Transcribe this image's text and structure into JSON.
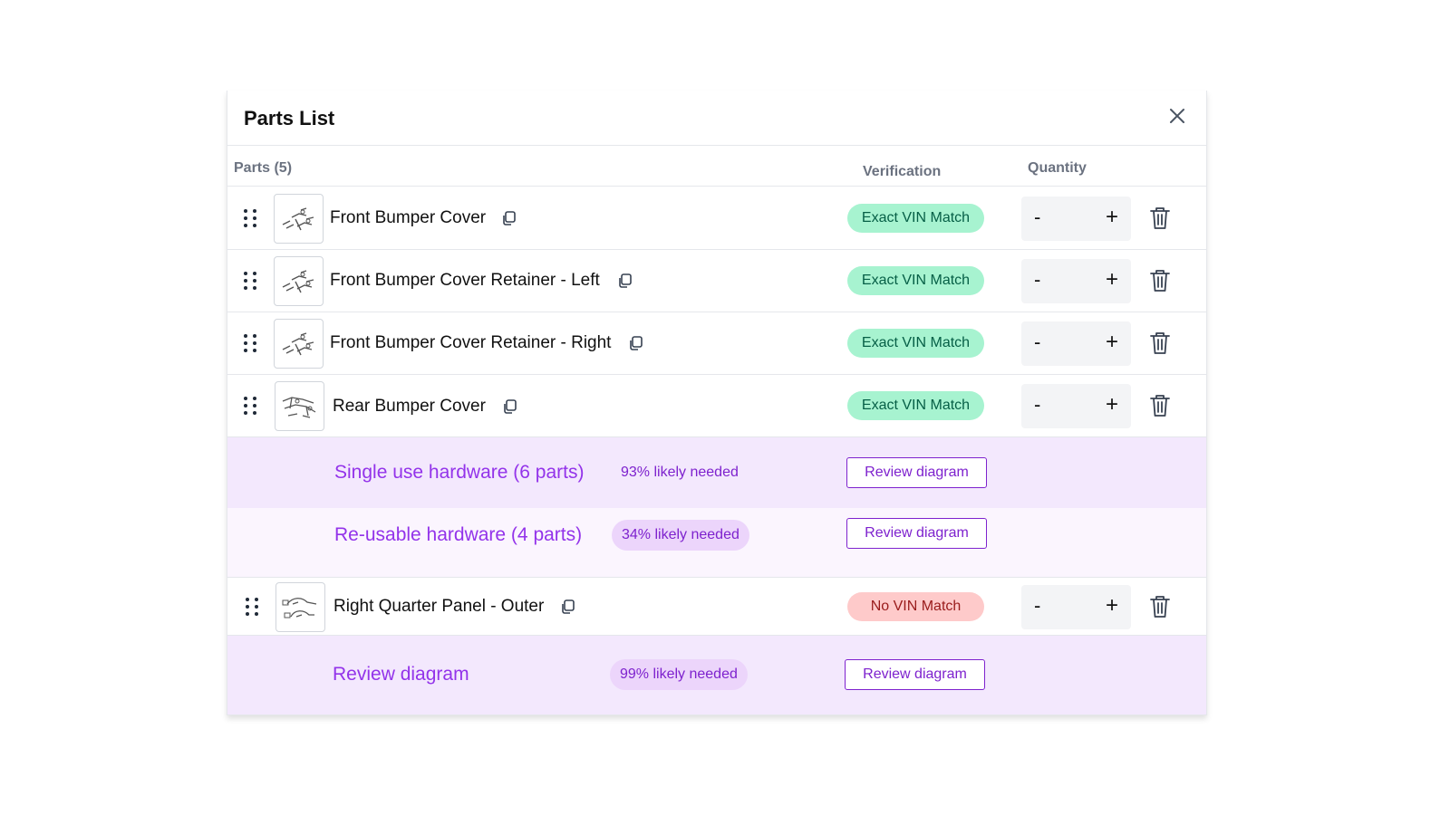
{
  "panel": {
    "title": "Parts List",
    "close_icon": "close-icon"
  },
  "columns": {
    "parts": "Parts (5)",
    "verification": "Verification",
    "quantity": "Quantity"
  },
  "parts": [
    {
      "name": "Front Bumper Cover",
      "verification": "Exact VIN Match",
      "status": "ok"
    },
    {
      "name": "Front Bumper Cover Retainer - Left",
      "verification": "Exact VIN Match",
      "status": "ok"
    },
    {
      "name": "Front Bumper Cover Retainer - Right",
      "verification": "Exact VIN Match",
      "status": "ok"
    },
    {
      "name": "Rear Bumper Cover",
      "verification": "Exact VIN Match",
      "status": "ok"
    },
    {
      "name": "Right Quarter Panel - Outer",
      "verification": "No VIN Match",
      "status": "bad"
    }
  ],
  "quantity_controls": {
    "minus": "-",
    "plus": "+"
  },
  "hardware": [
    {
      "title": "Single use hardware (6 parts)",
      "likelihood": "93% likely needed",
      "button": "Review diagram"
    },
    {
      "title": "Re-usable hardware (4 parts)",
      "likelihood": "34% likely needed",
      "button": "Review diagram"
    },
    {
      "title": "Review diagram",
      "likelihood": "99% likely needed",
      "button": "Review diagram"
    }
  ],
  "colors": {
    "match_bg": "#a7f3d0",
    "match_text": "#065f46",
    "nomatch_bg": "#fecaca",
    "nomatch_text": "#991b1b",
    "hardware_accent": "#9333ea",
    "hardware_bg": "#f3e8fd",
    "hardware_bg_light": "#fbf5fe"
  }
}
